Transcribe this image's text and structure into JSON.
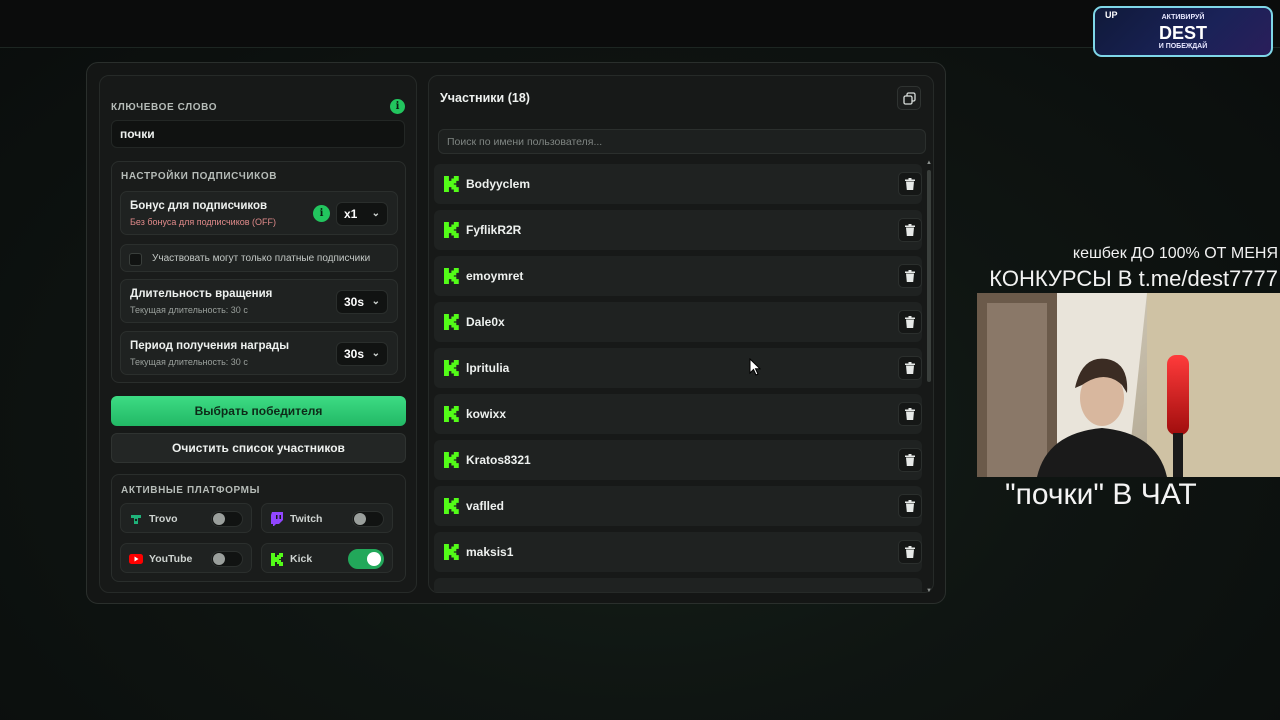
{
  "keyword": {
    "label": "Ключевое слово",
    "value": "почки"
  },
  "subscribers": {
    "title": "Настройки подписчиков",
    "bonus": {
      "title": "Бонус для подписчиков",
      "subtitle": "Без бонуса для подписчиков (OFF)",
      "value": "x1"
    },
    "paid_only_label": "Участвовать могут только платные подписчики",
    "spin_duration": {
      "title": "Длительность вращения",
      "subtitle": "Текущая длительность: 30 с",
      "value": "30s"
    },
    "claim_period": {
      "title": "Период получения награды",
      "subtitle": "Текущая длительность: 30 с",
      "value": "30s"
    }
  },
  "buttons": {
    "pick_winner": "Выбрать победителя",
    "clear_list": "Очистить список участников"
  },
  "platforms": {
    "title": "Активные платформы",
    "items": [
      {
        "name": "Trovo",
        "enabled": false,
        "color": "#1fb37a"
      },
      {
        "name": "Twitch",
        "enabled": false,
        "color": "#9146ff"
      },
      {
        "name": "YouTube",
        "enabled": false,
        "color": "#ff0000"
      },
      {
        "name": "Kick",
        "enabled": true,
        "color": "#53fc18"
      }
    ]
  },
  "participants": {
    "title": "Участники (18)",
    "search_placeholder": "Поиск по имени пользователя...",
    "users": [
      "Bodyyclem",
      "FyflikR2R",
      "emoymret",
      "Dale0x",
      "lpritulia",
      "kowixx",
      "Kratos8321",
      "vaflled",
      "maksis1"
    ]
  },
  "overlay": {
    "promo": {
      "badge": "UP",
      "line1": "АКТИВИРУЙ",
      "brand": "DEST",
      "line2": "И ПОБЕЖДАЙ"
    },
    "cashback": "кешбек ДО 100% ОТ МЕНЯ",
    "contests": "КОНКУРСЫ В t.me/dest7777",
    "caption": "\"почки\" В ЧАТ"
  },
  "colors": {
    "accent": "#22c55e",
    "kick": "#53fc18"
  }
}
